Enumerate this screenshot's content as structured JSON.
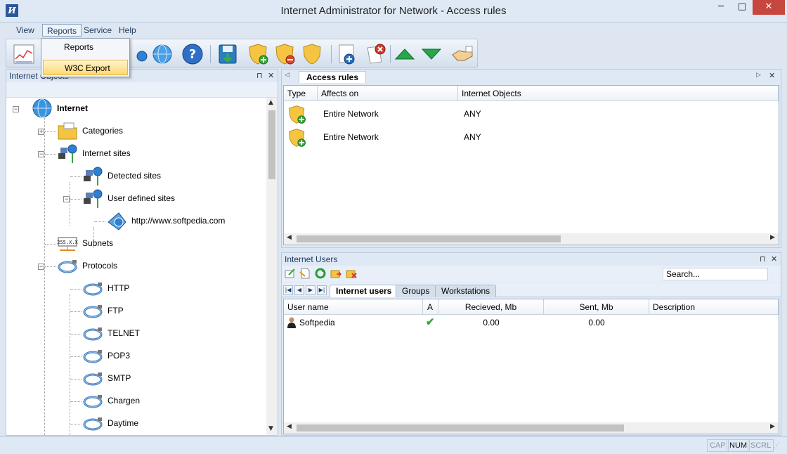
{
  "window": {
    "title": "Internet Administrator for Network - Access rules",
    "app_icon_letter": "И",
    "minimize": "─",
    "maximize": "□",
    "close": "✕"
  },
  "menu": {
    "items": [
      "View",
      "Reports",
      "Service",
      "Help"
    ]
  },
  "reports_dropdown": {
    "items": [
      "Reports",
      "W3C Export"
    ]
  },
  "toolbar": {
    "buttons": [
      "stats-chart-icon",
      "network-globe-icon",
      "globe-icon",
      "help-icon",
      "save-icon",
      "shield-add-icon",
      "shield-remove-icon",
      "shield-icon",
      "add-document-icon",
      "delete-document-icon",
      "move-up-icon",
      "move-down-icon",
      "handshake-icon"
    ]
  },
  "left_panel": {
    "title": "Internet Objects",
    "pin": "⊓",
    "close": "✕",
    "tree": [
      {
        "label": "Internet",
        "icon": "globe-icon",
        "level": 0,
        "expander": "-",
        "bold": true
      },
      {
        "label": "Categories",
        "icon": "folder-icon",
        "level": 1,
        "expander": "+"
      },
      {
        "label": "Internet sites",
        "icon": "network-icon",
        "level": 1,
        "expander": "-"
      },
      {
        "label": "Detected sites",
        "icon": "network-icon",
        "level": 2,
        "expander": ""
      },
      {
        "label": "User defined sites",
        "icon": "network-icon",
        "level": 2,
        "expander": "-"
      },
      {
        "label": "http://www.softpedia.com",
        "icon": "web-link-icon",
        "level": 3,
        "expander": ""
      },
      {
        "label": "Subnets",
        "icon": "subnet-icon",
        "level": 1,
        "expander": ""
      },
      {
        "label": "Protocols",
        "icon": "cable-icon",
        "level": 1,
        "expander": "-"
      },
      {
        "label": "HTTP",
        "icon": "cable-icon",
        "level": 2,
        "expander": ""
      },
      {
        "label": "FTP",
        "icon": "cable-icon",
        "level": 2,
        "expander": ""
      },
      {
        "label": "TELNET",
        "icon": "cable-icon",
        "level": 2,
        "expander": ""
      },
      {
        "label": "POP3",
        "icon": "cable-icon",
        "level": 2,
        "expander": ""
      },
      {
        "label": "SMTP",
        "icon": "cable-icon",
        "level": 2,
        "expander": ""
      },
      {
        "label": "Chargen",
        "icon": "cable-icon",
        "level": 2,
        "expander": ""
      },
      {
        "label": "Daytime",
        "icon": "cable-icon",
        "level": 2,
        "expander": ""
      }
    ]
  },
  "rules_panel": {
    "tab": "Access rules",
    "columns": [
      "Type",
      "Affects on",
      "Internet Objects"
    ],
    "rows": [
      {
        "type_icon": "shield-add-icon",
        "affects_on": "Entire Network",
        "objects": "ANY"
      },
      {
        "type_icon": "shield-add-icon",
        "affects_on": "Entire Network",
        "objects": "ANY"
      }
    ]
  },
  "users_panel": {
    "title": "Internet Users",
    "search_placeholder": "Search...",
    "tabs": [
      "Internet users",
      "Groups",
      "Workstations"
    ],
    "columns": [
      "User name",
      "A",
      "Recieved, Mb",
      "Sent, Mb",
      "Description"
    ],
    "rows": [
      {
        "name": "Softpedia",
        "active": "✔",
        "received": "0.00",
        "sent": "0.00",
        "description": ""
      }
    ]
  },
  "statusbar": {
    "cells": [
      "CAP",
      "NUM",
      "SCRL"
    ]
  },
  "colors": {
    "accent": "#2a579a",
    "close_red": "#c7463d",
    "shield_gold": "#f5c542",
    "add_green": "#3aa53a"
  }
}
